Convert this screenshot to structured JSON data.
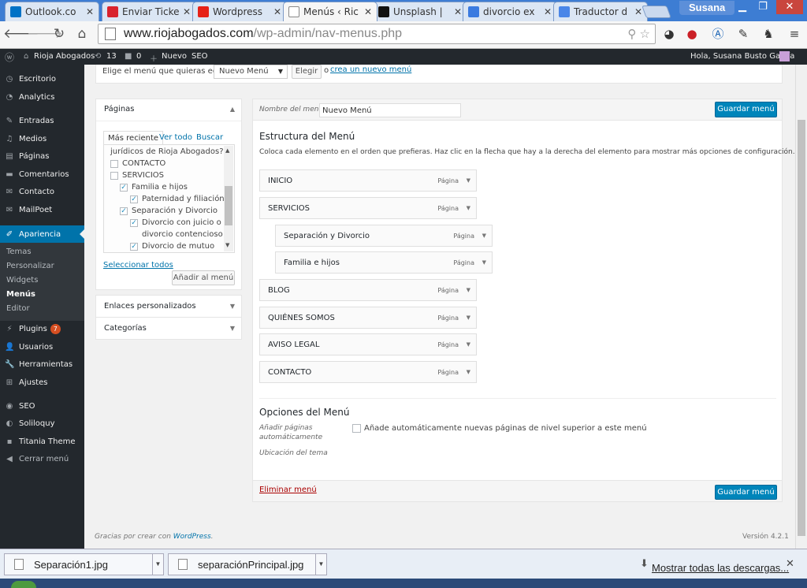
{
  "browser": {
    "tabs": [
      {
        "title": "Outlook.co",
        "icon": "outlook-icon",
        "color": "#0072c6"
      },
      {
        "title": "Enviar Ticke",
        "icon": "ticket-icon",
        "color": "#d9232d"
      },
      {
        "title": "Wordpress",
        "icon": "youtube-icon",
        "color": "#e62117"
      },
      {
        "title": "Menús ‹ Ric",
        "icon": "page-icon",
        "color": "#ffffff"
      },
      {
        "title": "Unsplash | ",
        "icon": "camera-icon",
        "color": "#111111"
      },
      {
        "title": "divorcio ex",
        "icon": "google-icon",
        "color": "#3b7be0"
      },
      {
        "title": "Traductor d",
        "icon": "translate-icon",
        "color": "#4a86e8"
      }
    ],
    "user": "Susana",
    "url_host": "www.riojabogados.com",
    "url_path": "/wp-admin/nav-menus.php"
  },
  "adminbar": {
    "site": "Rioja Abogados",
    "updates": "13",
    "comments": "0",
    "new": "Nuevo",
    "seo": "SEO",
    "greeting": "Hola, Susana Busto García"
  },
  "leftmenu": {
    "items": [
      "Escritorio",
      "Analytics",
      "Entradas",
      "Medios",
      "Páginas",
      "Comentarios",
      "Contacto",
      "MailPoet",
      "Apariencia"
    ],
    "submenu": [
      "Temas",
      "Personalizar",
      "Widgets",
      "Menús",
      "Editor"
    ],
    "items2": [
      "Plugins",
      "Usuarios",
      "Herramientas",
      "Ajustes",
      "SEO",
      "Soliloquy",
      "Titania Theme",
      "Cerrar menú"
    ],
    "plugins_badge": "7"
  },
  "topstrip": {
    "label": "Elige el menú que quieras editar:",
    "select": "Nuevo Menú",
    "choose": "Elegir",
    "or": "o",
    "create": "crea un nuevo menú",
    "dot": "."
  },
  "pages_box": {
    "title": "Páginas",
    "tabs": [
      "Más reciente",
      "Ver todo",
      "Buscar"
    ],
    "list": [
      {
        "label": "jurídicos de Rioja Abogados?",
        "checked": null,
        "indent": 0
      },
      {
        "label": "CONTACTO",
        "checked": false,
        "indent": 0
      },
      {
        "label": "SERVICIOS",
        "checked": false,
        "indent": 0
      },
      {
        "label": "Familia e hijos",
        "checked": true,
        "indent": 1
      },
      {
        "label": "Paternidad y filiación",
        "checked": true,
        "indent": 2
      },
      {
        "label": "Separación y Divorcio",
        "checked": true,
        "indent": 1
      },
      {
        "label": "Divorcio con juicio o",
        "checked": true,
        "indent": 2
      },
      {
        "label": "divorcio contencioso",
        "checked": null,
        "indent": 2
      },
      {
        "label": "Divorcio de mutuo",
        "checked": true,
        "indent": 2
      }
    ],
    "select_all": "Seleccionar todos",
    "add": "Añadir al menú"
  },
  "links_box": {
    "title": "Enlaces personalizados"
  },
  "cats_box": {
    "title": "Categorías"
  },
  "menu": {
    "name_label": "Nombre del menú",
    "name_value": "Nuevo Menú",
    "save": "Guardar menú",
    "structure_title": "Estructura del Menú",
    "structure_desc": "Coloca cada elemento en el orden que prefieras. Haz clic en la flecha que hay a la derecha del elemento para mostrar más opciones de configuración.",
    "items": [
      {
        "label": "INICIO",
        "type": "Página",
        "depth": 0
      },
      {
        "label": "SERVICIOS",
        "type": "Página",
        "depth": 0
      },
      {
        "label": "Separación y Divorcio",
        "type": "Página",
        "depth": 1
      },
      {
        "label": "Familia e hijos",
        "type": "Página",
        "depth": 1
      },
      {
        "label": "BLOG",
        "type": "Página",
        "depth": 0
      },
      {
        "label": "QUIÉNES SOMOS",
        "type": "Página",
        "depth": 0
      },
      {
        "label": "AVISO LEGAL",
        "type": "Página",
        "depth": 0
      },
      {
        "label": "CONTACTO",
        "type": "Página",
        "depth": 0
      }
    ],
    "options_title": "Opciones del Menú",
    "auto_label_1": "Añadir páginas",
    "auto_label_2": "automáticamente",
    "auto_text": "Añade automáticamente nuevas páginas de nivel superior a este menú",
    "location_label": "Ubicación del tema",
    "delete": "Eliminar menú"
  },
  "footer": {
    "credit": "Gracias por crear con",
    "credit_link": "WordPress",
    "credit_end": ".",
    "version": "Versión 4.2.1"
  },
  "downloads": {
    "files": [
      "Separación1.jpg",
      "separaciónPrincipal.jpg"
    ],
    "show_all": "Mostrar todas las descargas..."
  }
}
